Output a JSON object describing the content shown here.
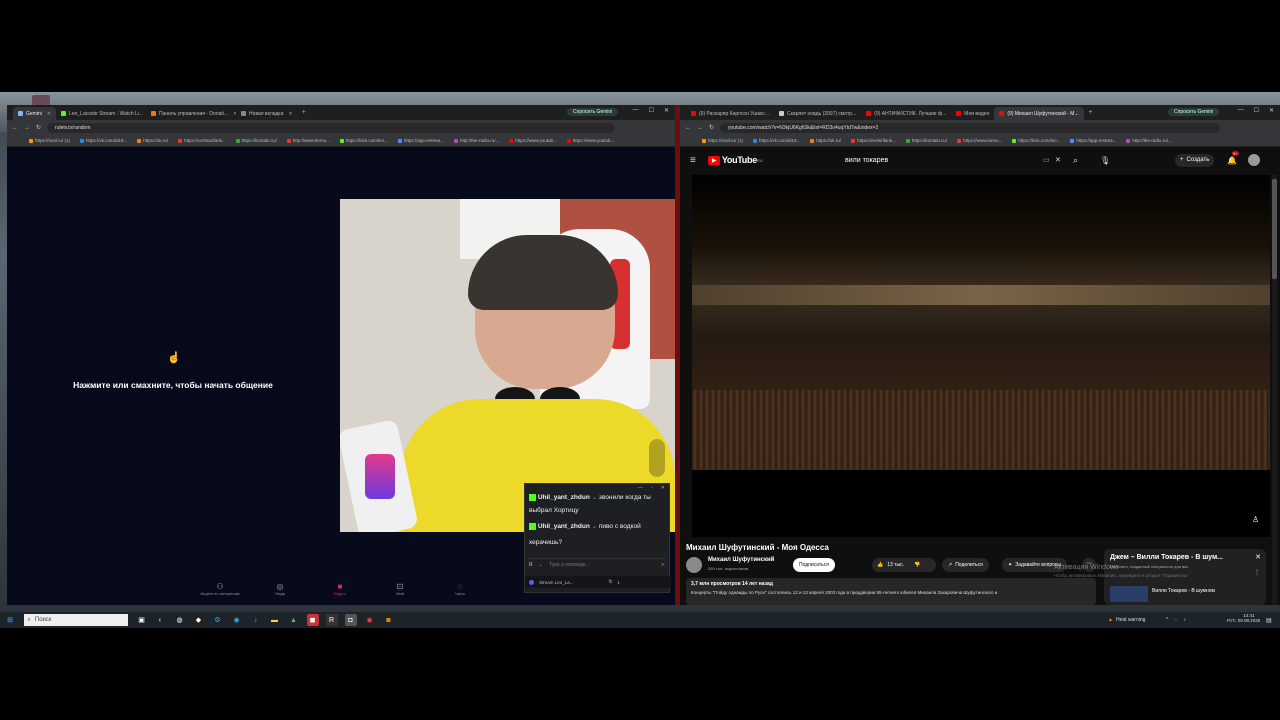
{
  "colors": {
    "yt_red": "#ff0000",
    "ome_bg": "#070a1a",
    "accent_purple": "#5b5ff0",
    "kick_green": "#53fc18"
  },
  "left_window": {
    "tabs": [
      {
        "label": "Gemini",
        "active": true
      },
      {
        "label": "Leo_Lacoste Stream - Watch Li..."
      },
      {
        "label": "Панель управления - Donati..."
      },
      {
        "label": "Новая вкладка"
      }
    ],
    "gemini_button": "Спросить Gemini",
    "url": "ruletv.tv/random",
    "bookmarks": [
      "https://mail.ru/ (1)",
      "https://vk.com/id19...",
      "https://ok.ru/",
      "https://vorlotovfank...",
      "https://kontakt.cu/",
      "http://www.bemu...",
      "https://kick.com/leo...",
      "https://app.restrea...",
      "http://the-radio.ru/...",
      "https://www.youtub...",
      "https://www.youtub..."
    ],
    "prompt_text": "Нажмите или смахните, чтобы начать общение",
    "nav_items": [
      "Ищите по интересам",
      "Люди",
      "Видео",
      "Мой",
      "Чаты"
    ],
    "chat": {
      "messages": [
        {
          "user": "Uhil_yant_zhdun",
          "text": "звонили когда ты выбрал Хортицу"
        },
        {
          "user": "Uhil_yant_zhdun",
          "text": "пиво с водкой херачишь?"
        }
      ],
      "input_placeholder": "Type a message...",
      "footer_label": "Stream Leo_La...",
      "footer_count": "1"
    }
  },
  "right_window": {
    "tabs": [
      {
        "label": "(9) Раскаряр Карлсон Ушакс..."
      },
      {
        "label": "Скарлет новдь (2007) смотр..."
      },
      {
        "label": "(9) АНТИФИСТИК. Лучшие ф..."
      },
      {
        "label": "Мои видео"
      },
      {
        "label": "(9) Михаил Шуфутинский - М...",
        "active": true
      }
    ],
    "gemini_button": "Спросить Gemini",
    "url": "youtube.com/watch?v=N3kjU6Kg63k&list=RD3o4uqYtd7w&index=2",
    "bookmarks": [
      "https://mail.ru/ (1)",
      "https://vk.com/id19...",
      "https://ok.ru/",
      "https://workirflank...",
      "https://kontakt.cu/",
      "https://www.bemu...",
      "https://kick.com/leo...",
      "https://app.restrea...",
      "http://the-radio.ru/..."
    ],
    "youtube": {
      "logo_text": "YouTube",
      "logo_sup": "RU",
      "search_value": "вили токарев",
      "create_label": "Создать",
      "notif_count": "9+",
      "video_title": "Михаил Шуфутинский - Моя Одесса",
      "channel_name": "Михаил Шуфутинский",
      "subscribers": "269 тыс. подписчиков",
      "subscribe_label": "Подписаться",
      "likes": "13 тыс.",
      "share_label": "Поделиться",
      "ask_label": "Задавайте вопросы",
      "views_line": "3,7 млн просмотров  14 лет назад",
      "description": "Концерты \"Пойду однажды по Руси\" состоялись 12 и 13 апреля 2003 года в преддверии 55-летнего юбилея Михаила Захаровича Шуфутинского и",
      "playlist_title": "Джем – Вилли Токарев - В шум...",
      "playlist_sub": "Плейлист, созданный специально для вас",
      "playlist_item": "Вилли Токарев - В шумном",
      "activation_title": "Активация Windows",
      "activation_sub": "Чтобы активировать Windows, перейдите в раздел \"Параметры\"."
    }
  },
  "taskbar": {
    "search_placeholder": "Поиск",
    "weather": "Heat warning",
    "lang": "РУС",
    "time": "14:41",
    "date": "09.08.2025"
  }
}
